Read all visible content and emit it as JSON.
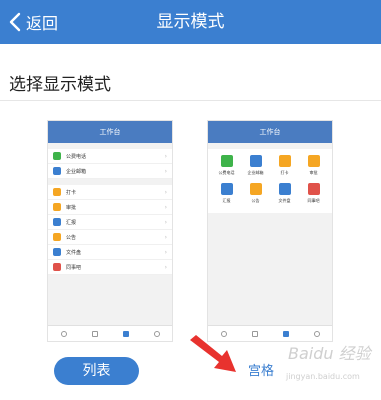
{
  "header": {
    "back_label": "返回",
    "title": "显示模式"
  },
  "section_title": "选择显示模式",
  "list_preview": {
    "title": "工作台",
    "group1": [
      {
        "label": "公费电话",
        "color": "#3eb34a"
      },
      {
        "label": "企业邮箱",
        "color": "#3b7fd0"
      }
    ],
    "group2": [
      {
        "label": "打卡",
        "color": "#f5a623"
      },
      {
        "label": "审批",
        "color": "#f5a623"
      },
      {
        "label": "汇报",
        "color": "#3b7fd0"
      },
      {
        "label": "公告",
        "color": "#f5a623"
      },
      {
        "label": "文件盘",
        "color": "#3b7fd0"
      },
      {
        "label": "同事吧",
        "color": "#e0524a"
      }
    ]
  },
  "grid_preview": {
    "title": "工作台",
    "items": [
      {
        "label": "公费电话",
        "color": "#3eb34a"
      },
      {
        "label": "企业邮箱",
        "color": "#3b7fd0"
      },
      {
        "label": "打卡",
        "color": "#f5a623"
      },
      {
        "label": "审批",
        "color": "#f5a623"
      },
      {
        "label": "汇报",
        "color": "#3b7fd0"
      },
      {
        "label": "公告",
        "color": "#f5a623"
      },
      {
        "label": "文件盘",
        "color": "#3b7fd0"
      },
      {
        "label": "同事吧",
        "color": "#e0524a"
      }
    ]
  },
  "buttons": {
    "list_label": "列表",
    "grid_label": "宫格"
  },
  "watermark": {
    "line1": "Baidu 经验",
    "line2": "jingyan.baidu.com"
  },
  "colors": {
    "accent": "#3b7fd0",
    "arrow": "#e8322e"
  }
}
